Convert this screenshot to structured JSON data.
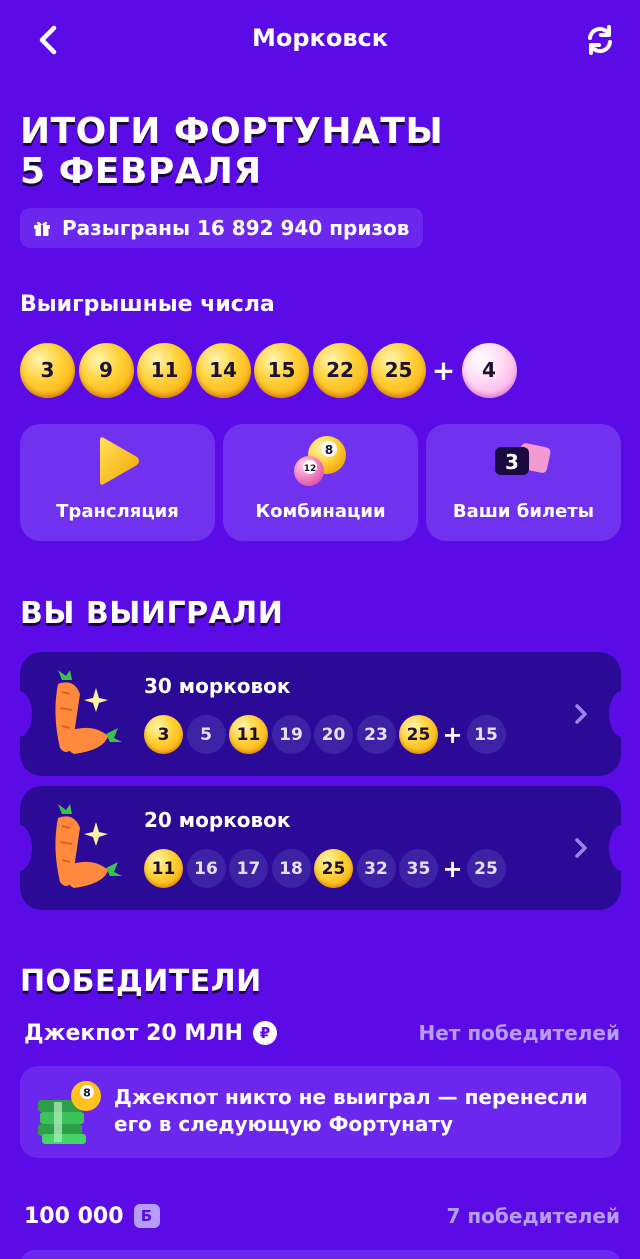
{
  "header": {
    "back_icon": "chevron-left-icon",
    "title": "Морковск",
    "refresh_icon": "refresh-icon"
  },
  "headline": {
    "line1": "ИТОГИ ФОРТУНАТЫ",
    "line2": "5 ФЕВРАЛЯ"
  },
  "prizes_badge": {
    "icon": "gift-icon",
    "text": "Разыграны 16 892 940 призов"
  },
  "winning_numbers": {
    "label": "Выигрышные числа",
    "main": [
      "3",
      "9",
      "11",
      "14",
      "15",
      "22",
      "25"
    ],
    "plus": "+",
    "bonus": "4"
  },
  "actions": [
    {
      "label": "Трансляция",
      "icon": "play-icon"
    },
    {
      "label": "Комбинации",
      "icon": "lottery-balls-icon"
    },
    {
      "label": "Ваши билеты",
      "icon": "ticket-icon",
      "count": "3"
    }
  ],
  "you_won": {
    "title": "ВЫ ВЫИГРАЛИ",
    "tickets": [
      {
        "prize": "30 морковок",
        "icon": "carrot-icon",
        "numbers": [
          {
            "n": "3",
            "hit": true
          },
          {
            "n": "5",
            "hit": false
          },
          {
            "n": "11",
            "hit": true
          },
          {
            "n": "19",
            "hit": false
          },
          {
            "n": "20",
            "hit": false
          },
          {
            "n": "23",
            "hit": false
          },
          {
            "n": "25",
            "hit": true
          }
        ],
        "plus": "+",
        "bonus": "15"
      },
      {
        "prize": "20 морковок",
        "icon": "carrot-icon",
        "numbers": [
          {
            "n": "11",
            "hit": true
          },
          {
            "n": "16",
            "hit": false
          },
          {
            "n": "17",
            "hit": false
          },
          {
            "n": "18",
            "hit": false
          },
          {
            "n": "25",
            "hit": true
          },
          {
            "n": "32",
            "hit": false
          },
          {
            "n": "35",
            "hit": false
          }
        ],
        "plus": "+",
        "bonus": "25"
      }
    ]
  },
  "winners": {
    "title": "ПОБЕДИТЕЛИ",
    "jackpot": {
      "label": "Джекпот 20 МЛН",
      "currency": "₽",
      "status": "Нет победителей"
    },
    "jackpot_note": "Джекпот никто не выиграл — перенесли его в следующую Фортунату",
    "tier2": {
      "amount": "100 000",
      "currency": "Б",
      "status": "7 победителей"
    }
  },
  "colors": {
    "background": "#5b0ce6",
    "card": "#7132f0",
    "ticket": "#2a0a96",
    "gold_ball": "#ffd23a",
    "pink_ball": "#f39ae0",
    "muted_text": "#b79dfb"
  }
}
